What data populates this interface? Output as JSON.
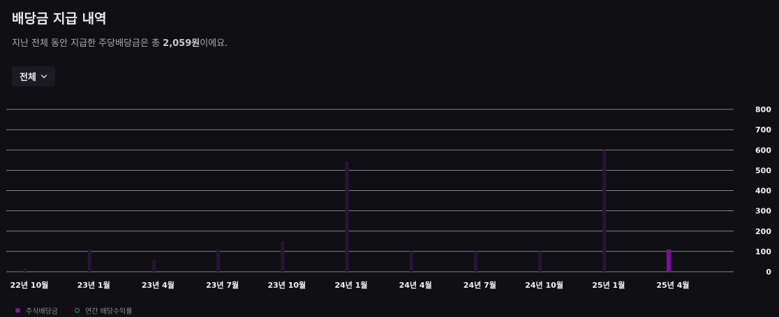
{
  "header": {
    "title": "배당금 지급 내역",
    "subtitle_prefix": "지난 전체 동안 지급한 주당배당금은 총 ",
    "subtitle_amount": "2,059원",
    "subtitle_suffix": "이에요."
  },
  "filter": {
    "label": "전체"
  },
  "colors": {
    "bar_highlight": "#7b0fa0",
    "bar_faded": "#2a1438",
    "grid": "#c8c8cc",
    "yield_ring": "#1f9d55"
  },
  "legend": {
    "dividend": "주식배당금",
    "yield": "연간 배당수익률"
  },
  "chart_data": {
    "type": "bar",
    "categories": [
      "22년 10월",
      "23년 1월",
      "23년 4월",
      "23년 7월",
      "23년 10월",
      "24년 1월",
      "24년 4월",
      "24년 7월",
      "24년 10월",
      "25년 1월",
      "25년 4월"
    ],
    "series": [
      {
        "name": "주식배당금",
        "values": [
          15,
          110,
          55,
          110,
          150,
          543,
          100,
          100,
          100,
          600,
          110
        ]
      }
    ],
    "highlight_index": 10,
    "ylim": [
      0,
      800
    ],
    "yticks": [
      "0",
      "100",
      "200",
      "300",
      "400",
      "500",
      "600",
      "700",
      "800"
    ],
    "grid": true,
    "legend_position": "bottom-left"
  }
}
